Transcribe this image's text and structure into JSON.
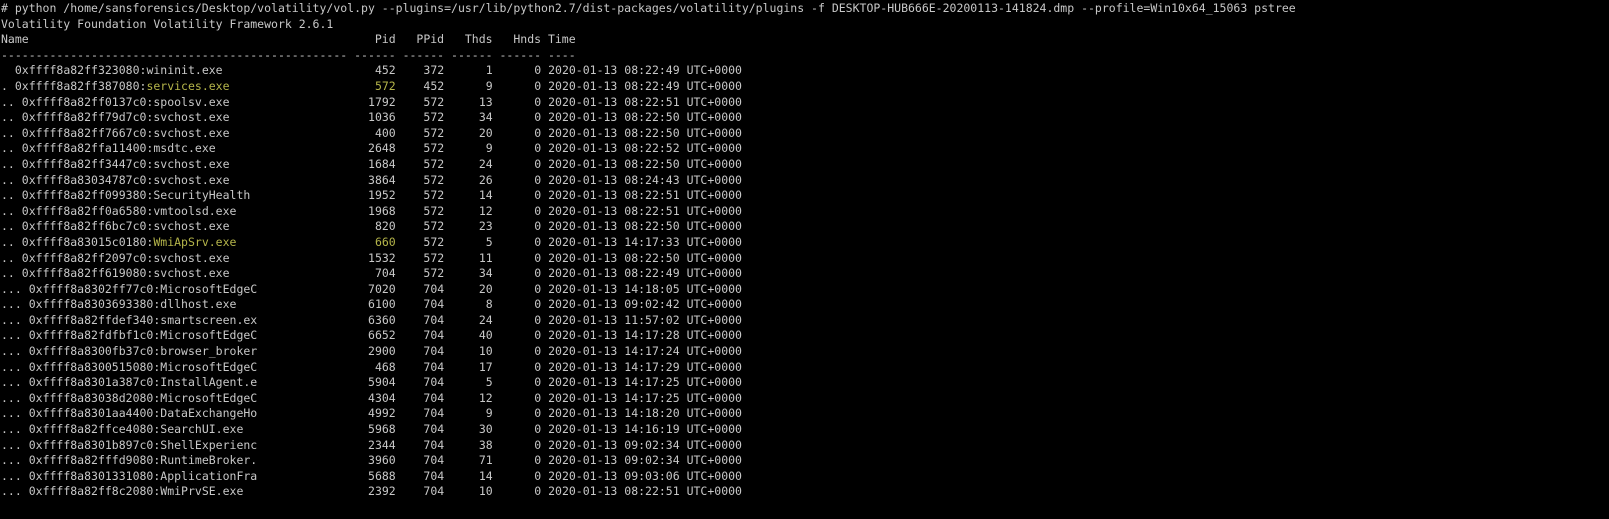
{
  "terminal": {
    "command": "# python /home/sansforensics/Desktop/volatility/vol.py --plugins=/usr/lib/python2.7/dist-packages/volatility/plugins -f DESKTOP-HUB666E-20200113-141824.dmp --profile=Win10x64_15063 pstree",
    "banner": "Volatility Foundation Volatility Framework 2.6.1",
    "header": "Name                                                  Pid   PPid   Thds   Hnds Time",
    "separator": "-------------------------------------------------- ------ ------ ------ ------ ----",
    "colors": {
      "background": "#000000",
      "text": "#c8c8c8",
      "highlight": "#b5b54a"
    },
    "rows": [
      {
        "indent": " ",
        "offset": "0xffff8a82ff323080",
        "name": "wininit.exe",
        "pid": "452",
        "ppid": "372",
        "thds": "1",
        "hnds": "0",
        "time": "2020-01-13 08:22:49 UTC+0000",
        "highlight": false
      },
      {
        "indent": ".",
        "offset": "0xffff8a82ff387080",
        "name": "services.exe",
        "pid": "572",
        "ppid": "452",
        "thds": "9",
        "hnds": "0",
        "time": "2020-01-13 08:22:49 UTC+0000",
        "highlight": true
      },
      {
        "indent": "..",
        "offset": "0xffff8a82ff0137c0",
        "name": "spoolsv.exe",
        "pid": "1792",
        "ppid": "572",
        "thds": "13",
        "hnds": "0",
        "time": "2020-01-13 08:22:51 UTC+0000",
        "highlight": false
      },
      {
        "indent": "..",
        "offset": "0xffff8a82ff79d7c0",
        "name": "svchost.exe",
        "pid": "1036",
        "ppid": "572",
        "thds": "34",
        "hnds": "0",
        "time": "2020-01-13 08:22:50 UTC+0000",
        "highlight": false
      },
      {
        "indent": "..",
        "offset": "0xffff8a82ff7667c0",
        "name": "svchost.exe",
        "pid": "400",
        "ppid": "572",
        "thds": "20",
        "hnds": "0",
        "time": "2020-01-13 08:22:50 UTC+0000",
        "highlight": false
      },
      {
        "indent": "..",
        "offset": "0xffff8a82ffa11400",
        "name": "msdtc.exe",
        "pid": "2648",
        "ppid": "572",
        "thds": "9",
        "hnds": "0",
        "time": "2020-01-13 08:22:52 UTC+0000",
        "highlight": false
      },
      {
        "indent": "..",
        "offset": "0xffff8a82ff3447c0",
        "name": "svchost.exe",
        "pid": "1684",
        "ppid": "572",
        "thds": "24",
        "hnds": "0",
        "time": "2020-01-13 08:22:50 UTC+0000",
        "highlight": false
      },
      {
        "indent": "..",
        "offset": "0xffff8a83034787c0",
        "name": "svchost.exe",
        "pid": "3864",
        "ppid": "572",
        "thds": "26",
        "hnds": "0",
        "time": "2020-01-13 08:24:43 UTC+0000",
        "highlight": false
      },
      {
        "indent": "..",
        "offset": "0xffff8a82ff099380",
        "name": "SecurityHealth",
        "pid": "1952",
        "ppid": "572",
        "thds": "14",
        "hnds": "0",
        "time": "2020-01-13 08:22:51 UTC+0000",
        "highlight": false
      },
      {
        "indent": "..",
        "offset": "0xffff8a82ff0a6580",
        "name": "vmtoolsd.exe",
        "pid": "1968",
        "ppid": "572",
        "thds": "12",
        "hnds": "0",
        "time": "2020-01-13 08:22:51 UTC+0000",
        "highlight": false
      },
      {
        "indent": "..",
        "offset": "0xffff8a82ff6bc7c0",
        "name": "svchost.exe",
        "pid": "820",
        "ppid": "572",
        "thds": "23",
        "hnds": "0",
        "time": "2020-01-13 08:22:50 UTC+0000",
        "highlight": false
      },
      {
        "indent": "..",
        "offset": "0xffff8a83015c0180",
        "name": "WmiApSrv.exe",
        "pid": "660",
        "ppid": "572",
        "thds": "5",
        "hnds": "0",
        "time": "2020-01-13 14:17:33 UTC+0000",
        "highlight": true
      },
      {
        "indent": "..",
        "offset": "0xffff8a82ff2097c0",
        "name": "svchost.exe",
        "pid": "1532",
        "ppid": "572",
        "thds": "11",
        "hnds": "0",
        "time": "2020-01-13 08:22:50 UTC+0000",
        "highlight": false
      },
      {
        "indent": "..",
        "offset": "0xffff8a82ff619080",
        "name": "svchost.exe",
        "pid": "704",
        "ppid": "572",
        "thds": "34",
        "hnds": "0",
        "time": "2020-01-13 08:22:49 UTC+0000",
        "highlight": false
      },
      {
        "indent": "...",
        "offset": "0xffff8a8302ff77c0",
        "name": "MicrosoftEdgeC",
        "pid": "7020",
        "ppid": "704",
        "thds": "20",
        "hnds": "0",
        "time": "2020-01-13 14:18:05 UTC+0000",
        "highlight": false
      },
      {
        "indent": "...",
        "offset": "0xffff8a8303693380",
        "name": "dllhost.exe",
        "pid": "6100",
        "ppid": "704",
        "thds": "8",
        "hnds": "0",
        "time": "2020-01-13 09:02:42 UTC+0000",
        "highlight": false
      },
      {
        "indent": "...",
        "offset": "0xffff8a82ffdef340",
        "name": "smartscreen.ex",
        "pid": "6360",
        "ppid": "704",
        "thds": "24",
        "hnds": "0",
        "time": "2020-01-13 11:57:02 UTC+0000",
        "highlight": false
      },
      {
        "indent": "...",
        "offset": "0xffff8a82fdfbf1c0",
        "name": "MicrosoftEdgeC",
        "pid": "6652",
        "ppid": "704",
        "thds": "40",
        "hnds": "0",
        "time": "2020-01-13 14:17:28 UTC+0000",
        "highlight": false
      },
      {
        "indent": "...",
        "offset": "0xffff8a8300fb37c0",
        "name": "browser_broker",
        "pid": "2900",
        "ppid": "704",
        "thds": "10",
        "hnds": "0",
        "time": "2020-01-13 14:17:24 UTC+0000",
        "highlight": false
      },
      {
        "indent": "...",
        "offset": "0xffff8a8300515080",
        "name": "MicrosoftEdgeC",
        "pid": "468",
        "ppid": "704",
        "thds": "17",
        "hnds": "0",
        "time": "2020-01-13 14:17:29 UTC+0000",
        "highlight": false
      },
      {
        "indent": "...",
        "offset": "0xffff8a8301a387c0",
        "name": "InstallAgent.e",
        "pid": "5904",
        "ppid": "704",
        "thds": "5",
        "hnds": "0",
        "time": "2020-01-13 14:17:25 UTC+0000",
        "highlight": false
      },
      {
        "indent": "...",
        "offset": "0xffff8a83038d2080",
        "name": "MicrosoftEdgeC",
        "pid": "4304",
        "ppid": "704",
        "thds": "12",
        "hnds": "0",
        "time": "2020-01-13 14:17:25 UTC+0000",
        "highlight": false
      },
      {
        "indent": "...",
        "offset": "0xffff8a8301aa4400",
        "name": "DataExchangeHo",
        "pid": "4992",
        "ppid": "704",
        "thds": "9",
        "hnds": "0",
        "time": "2020-01-13 14:18:20 UTC+0000",
        "highlight": false
      },
      {
        "indent": "...",
        "offset": "0xffff8a82ffce4080",
        "name": "SearchUI.exe",
        "pid": "5968",
        "ppid": "704",
        "thds": "30",
        "hnds": "0",
        "time": "2020-01-13 14:16:19 UTC+0000",
        "highlight": false
      },
      {
        "indent": "...",
        "offset": "0xffff8a8301b897c0",
        "name": "ShellExperienc",
        "pid": "2344",
        "ppid": "704",
        "thds": "38",
        "hnds": "0",
        "time": "2020-01-13 09:02:34 UTC+0000",
        "highlight": false
      },
      {
        "indent": "...",
        "offset": "0xffff8a82fffd9080",
        "name": "RuntimeBroker.",
        "pid": "3960",
        "ppid": "704",
        "thds": "71",
        "hnds": "0",
        "time": "2020-01-13 09:02:34 UTC+0000",
        "highlight": false
      },
      {
        "indent": "...",
        "offset": "0xffff8a8301331080",
        "name": "ApplicationFra",
        "pid": "5688",
        "ppid": "704",
        "thds": "14",
        "hnds": "0",
        "time": "2020-01-13 09:03:06 UTC+0000",
        "highlight": false
      },
      {
        "indent": "...",
        "offset": "0xffff8a82ff8c2080",
        "name": "WmiPrvSE.exe",
        "pid": "2392",
        "ppid": "704",
        "thds": "10",
        "hnds": "0",
        "time": "2020-01-13 08:22:51 UTC+0000",
        "highlight": false
      }
    ]
  }
}
